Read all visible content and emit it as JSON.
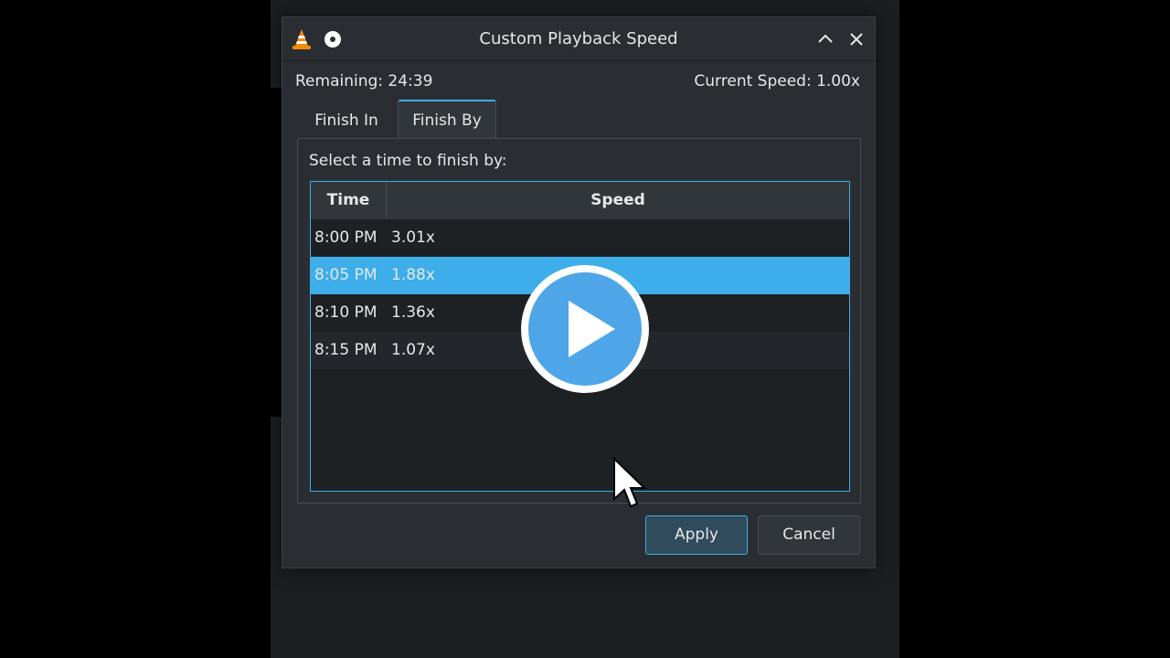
{
  "window": {
    "title": "Custom Playback Speed",
    "app_icon": "vlc-cone-icon",
    "pin_icon": "pin-icon",
    "collapse_glyph": "⌃",
    "close_glyph": "✕"
  },
  "info": {
    "remaining": "Remaining: 24:39",
    "current_speed": "Current Speed: 1.00x"
  },
  "tabs": [
    {
      "label": "Finish In",
      "active": false
    },
    {
      "label": "Finish By",
      "active": true
    }
  ],
  "panel": {
    "label": "Select a time to finish by:"
  },
  "table": {
    "columns": [
      "Time",
      "Speed"
    ],
    "rows": [
      {
        "time": "8:00 PM",
        "speed": "3.01x",
        "selected": false
      },
      {
        "time": "8:05 PM",
        "speed": "1.88x",
        "selected": true
      },
      {
        "time": "8:10 PM",
        "speed": "1.36x",
        "selected": false
      },
      {
        "time": "8:15 PM",
        "speed": "1.07x",
        "selected": false
      }
    ]
  },
  "buttons": {
    "apply": "Apply",
    "cancel": "Cancel"
  },
  "colors": {
    "accent": "#3daee9",
    "play_overlay": "#4ea6e8"
  }
}
